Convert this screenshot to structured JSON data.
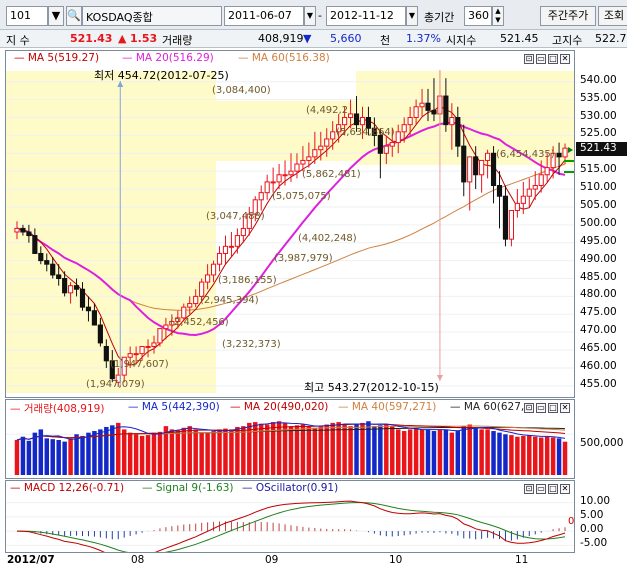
{
  "toolbar": {
    "code": "101",
    "code_dropdown_icon": "chevron-down-icon",
    "search_icon": "magnifier-icon",
    "market_name": "KOSDAQ종합",
    "start_date": "2011-06-07",
    "date_separator": "-",
    "end_date": "2012-11-12",
    "period_label": "총기간",
    "period_value": "360",
    "mode_button": "주간주가",
    "query_button": "조회"
  },
  "quote": {
    "label": "지 수",
    "price": "521.43",
    "change_icon": "up-triangle",
    "change": "1.53",
    "volume_label": "거래량",
    "volume": "408,919",
    "diff_icon": "down-triangle",
    "diff": "5,660",
    "diff_unit": "천",
    "rate": "1.37%",
    "open_label": "시지수",
    "open": "521.45",
    "high_label": "고지수",
    "high": "522.74"
  },
  "price_panel": {
    "ma5": "MA 5(519.27)",
    "ma20": "MA 20(516.29)",
    "ma60": "MA 60(516.38)",
    "current_price_tag": "521.43",
    "low_note": "최저 454.72(2012-07-25)",
    "high_note": "최고 543.27(2012-10-15)",
    "volume_notes": [
      "(3,084,400)",
      "(4,492,2",
      "(5,634,864)",
      "(5,862,481)",
      "(5,075,075)",
      "(3,047,488)",
      "(4,402,248)",
      "(3,987,979)",
      "(3,186,155)",
      "(2,945,394)",
      "(2,452,456)",
      "(3,232,373)",
      "(1,947,607)",
      "(1,947,079)",
      "(6,454,435)"
    ],
    "y_ticks": [
      "540.00",
      "535.00",
      "530.00",
      "525.00",
      "520.00",
      "515.00",
      "510.00",
      "505.00",
      "500.00",
      "495.00",
      "490.00",
      "485.00",
      "480.00",
      "475.00",
      "470.00",
      "465.00",
      "460.00",
      "455.00"
    ]
  },
  "volume_panel": {
    "label": "거래량(408,919)",
    "ma5": "MA 5(442,390)",
    "ma20": "MA 20(490,020)",
    "ma40": "MA 40(597,271)",
    "ma60": "MA 60(627,",
    "y_tick": "500,000"
  },
  "macd_panel": {
    "macd": "MACD 12,26(-0.71)",
    "signal": "Signal 9(-1.63)",
    "osc": "OScillator(0.91)",
    "y_ticks": [
      "10.00",
      "5.00",
      "0.00",
      "-5.00"
    ],
    "zero_marker": "0"
  },
  "date_axis": {
    "labels": [
      "2012/07",
      "08",
      "09",
      "10",
      "11"
    ]
  },
  "colors": {
    "up": "#e8151b",
    "down": "#111111",
    "ma5": "#c00000",
    "ma20": "#dd20dd",
    "ma60": "#d08040",
    "highlight": "#fffbc8",
    "vol_up": "#e8151b",
    "vol_down": "#1428c8",
    "macd": "#c00000",
    "signal": "#208020",
    "osc": "#1a1aa0"
  },
  "chart_data": {
    "type": "candlestick",
    "x": [
      "2012-07-02",
      "2012-07-03",
      "2012-07-04",
      "2012-07-05",
      "2012-07-06",
      "2012-07-09",
      "2012-07-10",
      "2012-07-11",
      "2012-07-12",
      "2012-07-13",
      "2012-07-16",
      "2012-07-17",
      "2012-07-18",
      "2012-07-19",
      "2012-07-20",
      "2012-07-23",
      "2012-07-24",
      "2012-07-25",
      "2012-07-26",
      "2012-07-27",
      "2012-07-30",
      "2012-07-31",
      "2012-08-01",
      "2012-08-02",
      "2012-08-03",
      "2012-08-06",
      "2012-08-07",
      "2012-08-08",
      "2012-08-09",
      "2012-08-10",
      "2012-08-13",
      "2012-08-14",
      "2012-08-16",
      "2012-08-17",
      "2012-08-20",
      "2012-08-21",
      "2012-08-22",
      "2012-08-23",
      "2012-08-24",
      "2012-08-27",
      "2012-08-28",
      "2012-08-29",
      "2012-08-30",
      "2012-08-31",
      "2012-09-03",
      "2012-09-04",
      "2012-09-05",
      "2012-09-06",
      "2012-09-07",
      "2012-09-10",
      "2012-09-11",
      "2012-09-12",
      "2012-09-13",
      "2012-09-14",
      "2012-09-17",
      "2012-09-18",
      "2012-09-19",
      "2012-09-20",
      "2012-09-21",
      "2012-09-24",
      "2012-09-25",
      "2012-09-26",
      "2012-09-27",
      "2012-09-28",
      "2012-10-02",
      "2012-10-04",
      "2012-10-05",
      "2012-10-08",
      "2012-10-09",
      "2012-10-10",
      "2012-10-11",
      "2012-10-12",
      "2012-10-15",
      "2012-10-16",
      "2012-10-17",
      "2012-10-18",
      "2012-10-19",
      "2012-10-22",
      "2012-10-23",
      "2012-10-24",
      "2012-10-25",
      "2012-10-26",
      "2012-10-29",
      "2012-10-30",
      "2012-10-31",
      "2012-11-01",
      "2012-11-02",
      "2012-11-05",
      "2012-11-06",
      "2012-11-07",
      "2012-11-08",
      "2012-11-09",
      "2012-11-12"
    ],
    "open": [
      498,
      499,
      498,
      497,
      492,
      490,
      489,
      486,
      485,
      481,
      483,
      482,
      477,
      476,
      472,
      466,
      462,
      456,
      458,
      463,
      464,
      464,
      466,
      466,
      467,
      471,
      472,
      473,
      474,
      477,
      478,
      480,
      484,
      486,
      489,
      492,
      494,
      494,
      497,
      499,
      503,
      507,
      509,
      512,
      512,
      514,
      514,
      515,
      517,
      518,
      519,
      521,
      522,
      524,
      526,
      528,
      530,
      531,
      528,
      530,
      527,
      525,
      520,
      522,
      523,
      526,
      528,
      530,
      533,
      534,
      532,
      531,
      536,
      528,
      530,
      522,
      512,
      519,
      514,
      518,
      520,
      511,
      508,
      496,
      504,
      506,
      508,
      510,
      511,
      514,
      516,
      520,
      519
    ],
    "high": [
      501,
      500,
      500,
      499,
      494,
      492,
      491,
      489,
      487,
      484,
      485,
      484,
      480,
      478,
      474,
      468,
      465,
      460,
      461,
      466,
      466,
      466,
      468,
      469,
      471,
      474,
      475,
      476,
      478,
      480,
      482,
      485,
      489,
      490,
      494,
      497,
      498,
      499,
      503,
      505,
      508,
      511,
      514,
      516,
      517,
      518,
      520,
      520,
      522,
      523,
      526,
      526,
      527,
      529,
      531,
      533,
      535,
      536,
      533,
      533,
      530,
      527,
      525,
      527,
      528,
      530,
      533,
      535,
      538,
      538,
      541,
      543.27,
      541,
      534,
      533,
      528,
      519,
      522,
      517,
      521,
      522,
      515,
      511,
      502,
      510,
      512,
      513,
      515,
      518,
      520,
      522,
      523,
      522.74
    ],
    "low": [
      496,
      497,
      495,
      492,
      489,
      487,
      485,
      483,
      480,
      478,
      480,
      476,
      473,
      472,
      466,
      460,
      456,
      454.72,
      456,
      460,
      461,
      462,
      463,
      464,
      466,
      468,
      469,
      471,
      473,
      475,
      477,
      479,
      482,
      484,
      487,
      489,
      491,
      492,
      495,
      497,
      501,
      504,
      507,
      509,
      510,
      511,
      512,
      513,
      515,
      516,
      517,
      518,
      519,
      521,
      523,
      525,
      527,
      526,
      524,
      525,
      522,
      513,
      517,
      519,
      520,
      523,
      525,
      528,
      530,
      529,
      529,
      528,
      526,
      521,
      519,
      508,
      504,
      510,
      509,
      513,
      506,
      499,
      494,
      494,
      502,
      503,
      505,
      507,
      509,
      512,
      513,
      514,
      517
    ],
    "close": [
      499,
      498,
      497,
      492,
      490,
      489,
      486,
      485,
      481,
      483,
      482,
      477,
      476,
      472,
      467,
      462,
      457,
      458,
      463,
      464,
      464,
      466,
      466,
      467,
      471,
      472,
      473,
      474,
      477,
      478,
      480,
      484,
      486,
      489,
      492,
      494,
      494,
      497,
      499,
      503,
      507,
      509,
      512,
      512,
      514,
      514,
      515,
      517,
      518,
      519,
      521,
      522,
      524,
      526,
      528,
      530,
      531,
      528,
      530,
      527,
      525,
      520,
      522,
      523,
      526,
      528,
      530,
      533,
      534,
      532,
      531,
      536,
      528,
      530,
      522,
      512,
      519,
      514,
      518,
      520,
      511,
      508,
      496,
      504,
      506,
      508,
      510,
      511,
      514,
      516,
      520,
      519,
      521.43
    ],
    "volume": [
      430,
      470,
      420,
      520,
      560,
      450,
      440,
      430,
      410,
      450,
      500,
      480,
      520,
      540,
      560,
      590,
      610,
      640,
      560,
      520,
      500,
      480,
      490,
      520,
      530,
      600,
      560,
      550,
      580,
      600,
      560,
      520,
      520,
      540,
      560,
      570,
      560,
      590,
      600,
      640,
      650,
      630,
      620,
      650,
      660,
      640,
      600,
      610,
      620,
      600,
      580,
      600,
      620,
      640,
      650,
      620,
      600,
      620,
      640,
      660,
      600,
      610,
      620,
      600,
      560,
      540,
      560,
      570,
      560,
      560,
      540,
      560,
      560,
      520,
      540,
      600,
      620,
      580,
      560,
      560,
      540,
      520,
      500,
      490,
      470,
      480,
      490,
      470,
      460,
      470,
      460,
      450,
      408.919
    ],
    "ylim": [
      453,
      543
    ],
    "volume_unit": "thousands"
  }
}
